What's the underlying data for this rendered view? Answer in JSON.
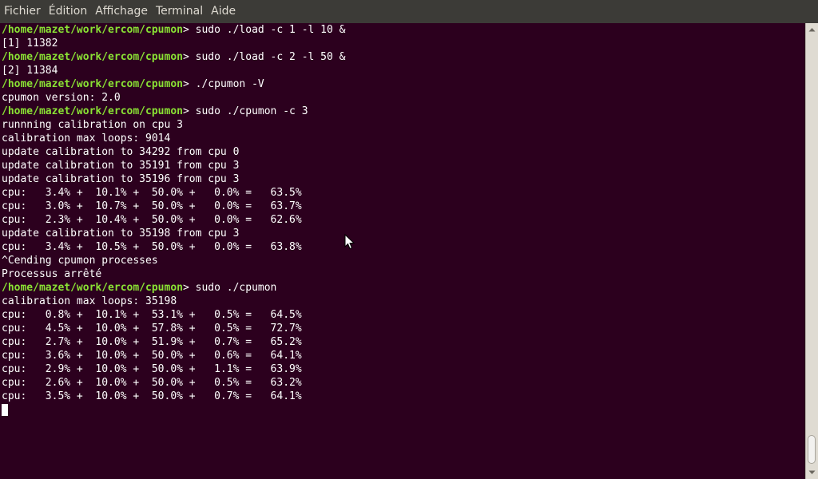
{
  "menu": {
    "items": [
      "Fichier",
      "Édition",
      "Affichage",
      "Terminal",
      "Aide"
    ]
  },
  "terminal": {
    "lines": [
      {
        "prompt": "/home/mazet/work/ercom/cpumon",
        "text": "> sudo ./load -c 1 -l 10 &"
      },
      {
        "prompt": "",
        "text": "[1] 11382"
      },
      {
        "prompt": "/home/mazet/work/ercom/cpumon",
        "text": "> sudo ./load -c 2 -l 50 &"
      },
      {
        "prompt": "",
        "text": "[2] 11384"
      },
      {
        "prompt": "/home/mazet/work/ercom/cpumon",
        "text": "> ./cpumon -V"
      },
      {
        "prompt": "",
        "text": "cpumon version: 2.0"
      },
      {
        "prompt": "/home/mazet/work/ercom/cpumon",
        "text": "> sudo ./cpumon -c 3"
      },
      {
        "prompt": "",
        "text": "runnning calibration on cpu 3"
      },
      {
        "prompt": "",
        "text": "calibration max loops: 9014"
      },
      {
        "prompt": "",
        "text": "update calibration to 34292 from cpu 0"
      },
      {
        "prompt": "",
        "text": "update calibration to 35191 from cpu 3"
      },
      {
        "prompt": "",
        "text": "update calibration to 35196 from cpu 3"
      },
      {
        "prompt": "",
        "text": "cpu:   3.4% +  10.1% +  50.0% +   0.0% =   63.5%"
      },
      {
        "prompt": "",
        "text": "cpu:   3.0% +  10.7% +  50.0% +   0.0% =   63.7%"
      },
      {
        "prompt": "",
        "text": "cpu:   2.3% +  10.4% +  50.0% +   0.0% =   62.6%"
      },
      {
        "prompt": "",
        "text": "update calibration to 35198 from cpu 3"
      },
      {
        "prompt": "",
        "text": "cpu:   3.4% +  10.5% +  50.0% +   0.0% =   63.8%"
      },
      {
        "prompt": "",
        "text": "^Cending cpumon processes"
      },
      {
        "prompt": "",
        "text": "Processus arrêté"
      },
      {
        "prompt": "/home/mazet/work/ercom/cpumon",
        "text": "> sudo ./cpumon"
      },
      {
        "prompt": "",
        "text": "calibration max loops: 35198"
      },
      {
        "prompt": "",
        "text": "cpu:   0.8% +  10.1% +  53.1% +   0.5% =   64.5%"
      },
      {
        "prompt": "",
        "text": "cpu:   4.5% +  10.0% +  57.8% +   0.5% =   72.7%"
      },
      {
        "prompt": "",
        "text": "cpu:   2.7% +  10.0% +  51.9% +   0.7% =   65.2%"
      },
      {
        "prompt": "",
        "text": "cpu:   3.6% +  10.0% +  50.0% +   0.6% =   64.1%"
      },
      {
        "prompt": "",
        "text": "cpu:   2.9% +  10.0% +  50.0% +   1.1% =   63.9%"
      },
      {
        "prompt": "",
        "text": "cpu:   2.6% +  10.0% +  50.0% +   0.5% =   63.2%"
      },
      {
        "prompt": "",
        "text": "cpu:   3.5% +  10.0% +  50.0% +   0.7% =   64.1%"
      }
    ]
  },
  "colors": {
    "background": "#2c001e",
    "prompt": "#8ae234",
    "text": "#ffffff",
    "chrome": "#3c3b37"
  },
  "icons": {
    "cursor": "text-cursor-block",
    "pointer": "mouse-pointer-icon",
    "scroll_up": "arrow-up-icon",
    "scroll_down": "arrow-down-icon"
  }
}
